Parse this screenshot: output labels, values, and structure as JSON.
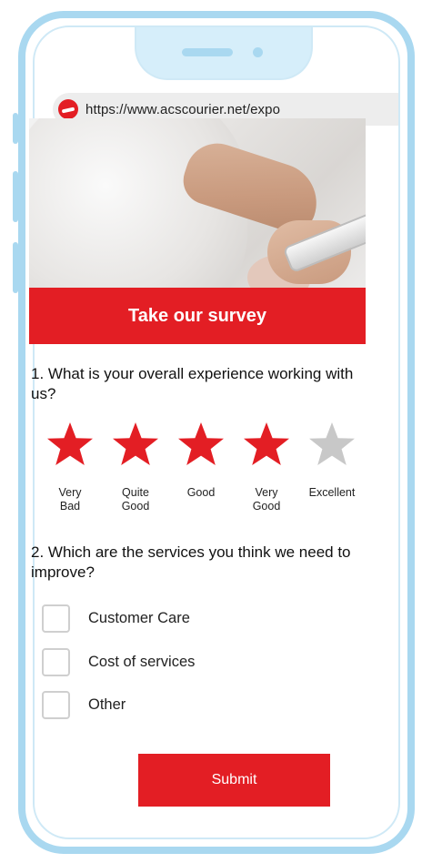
{
  "browser": {
    "url": "https://www.acscourier.net/expo"
  },
  "survey": {
    "banner_title": "Take our survey",
    "question1": "1. What is your overall experience working with us?",
    "rating": {
      "value": 4,
      "max": 5,
      "filled_color": "#e31e24",
      "empty_color": "#c8c8c8",
      "labels": [
        "Very\nBad",
        "Quite\nGood",
        "Good",
        "Very\nGood",
        "Excellent"
      ]
    },
    "question2": "2. Which are the services you think we need to improve?",
    "options": [
      {
        "label": "Customer Care",
        "checked": false
      },
      {
        "label": "Cost of services",
        "checked": false
      },
      {
        "label": "Other",
        "checked": false
      }
    ],
    "submit_label": "Submit"
  },
  "colors": {
    "brand_red": "#e31e24",
    "phone_frame": "#a9d8f0"
  }
}
